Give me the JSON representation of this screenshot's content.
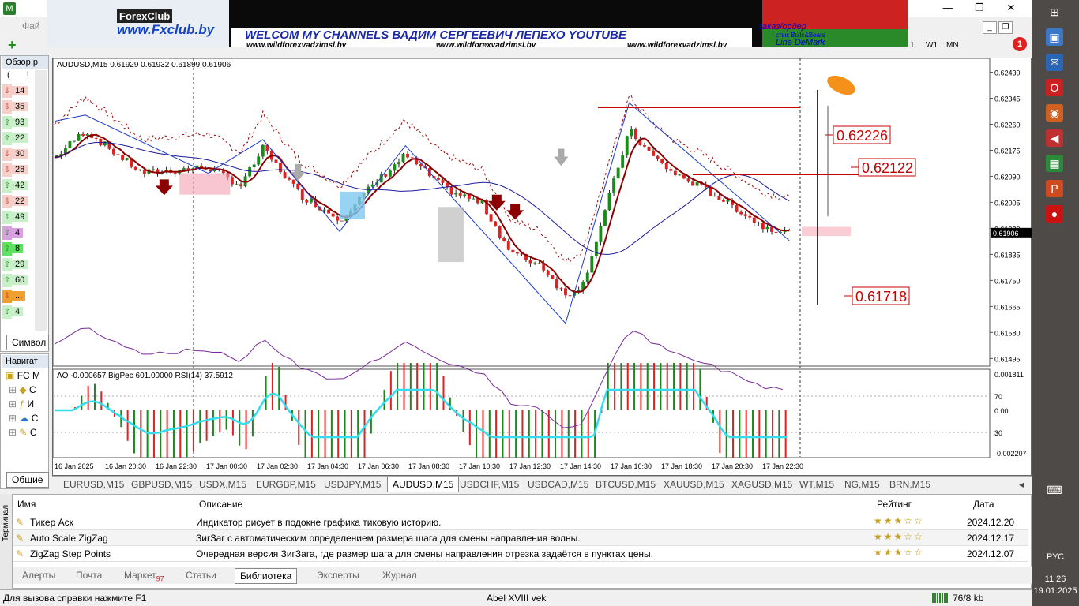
{
  "window": {
    "menu_file": "Фай"
  },
  "banner": {
    "forex_logo": "ForexClub",
    "fx_url": "www.Fxclub.by",
    "welcome": "WELCOM MY CHANNELS ВАДИМ СЕРГЕЕВИЧ ЛЕПЕХО YOUTUBE",
    "urls": [
      "www.wildforexvadzimsl.by",
      "www.wildforexvadzimsl.by",
      "www.wildforexvadzimsl.by"
    ],
    "order": "заказ/ордер",
    "bulls": "стык Bulls&Bears",
    "demark": "Line DeMark"
  },
  "toolbar": {
    "tf_1": "1",
    "tf_w1": "W1",
    "tf_mn": "MN",
    "notifications": "1"
  },
  "market_watch": {
    "title": "Обзор р",
    "head_left": "(",
    "head_right": "!",
    "rows": [
      {
        "value": "14",
        "dir": "down",
        "color": "#f6d0c8"
      },
      {
        "value": "35",
        "dir": "down",
        "color": "#f6d0c8"
      },
      {
        "value": "93",
        "dir": "up",
        "color": "#c8f0c8"
      },
      {
        "value": "22",
        "dir": "up",
        "color": "#c8f0c8"
      },
      {
        "value": "30",
        "dir": "down",
        "color": "#f6d0c8"
      },
      {
        "value": "28",
        "dir": "down",
        "color": "#f6d0c8"
      },
      {
        "value": "42",
        "dir": "up",
        "color": "#c8f0c8"
      },
      {
        "value": "22",
        "dir": "down",
        "color": "#f6d0c8"
      },
      {
        "value": "49",
        "dir": "up",
        "color": "#c8f0c8"
      },
      {
        "value": "4",
        "dir": "up",
        "color": "#d8a0e0"
      },
      {
        "value": "8",
        "dir": "up",
        "color": "#60e060"
      },
      {
        "value": "29",
        "dir": "up",
        "color": "#c8f0c8"
      },
      {
        "value": "60",
        "dir": "up",
        "color": "#c8f0c8"
      },
      {
        "value": "...",
        "dir": "down",
        "color": "#f0a030"
      },
      {
        "value": "4",
        "dir": "up",
        "color": "#c8f0c8"
      }
    ],
    "symbol_tab": "Символ"
  },
  "navigator": {
    "title": "Навигат",
    "root": "FC M",
    "items": [
      "С",
      "И",
      "С",
      "С"
    ],
    "common_tab": "Общие"
  },
  "chart": {
    "info": "AUDUSD,M15  0.61929 0.61932 0.61899 0.61906",
    "indicator_info": "AO -0.000657  BigPec 601.00000  RSI(14) 37.5912",
    "price_labels": [
      "0.62430",
      "0.62345",
      "0.62260",
      "0.62175",
      "0.62090",
      "0.62005",
      "0.61920",
      "0.61835",
      "0.61750",
      "0.61665",
      "0.61580",
      "0.61495"
    ],
    "current_price": "0.61906",
    "levels": [
      "0.62226",
      "0.62122",
      "0.61718"
    ],
    "sub_labels": [
      "0.001811",
      "70",
      "0.00",
      "30",
      "-0.002207"
    ],
    "time_labels": [
      "16 Jan 2025",
      "16 Jan 20:30",
      "16 Jan 22:30",
      "17 Jan 00:30",
      "17 Jan 02:30",
      "17 Jan 04:30",
      "17 Jan 06:30",
      "17 Jan 08:30",
      "17 Jan 10:30",
      "17 Jan 12:30",
      "17 Jan 14:30",
      "17 Jan 16:30",
      "17 Jan 18:30",
      "17 Jan 20:30",
      "17 Jan 22:30"
    ],
    "colors": {
      "bull": "#1a8a1a",
      "bear": "#dd2222",
      "ma": "#8b0000",
      "ma2": "#1a1a9a",
      "level": "#cc0000",
      "rsi": "#33ddee"
    }
  },
  "chart_tabs": [
    "EURUSD,M15",
    "GBPUSD,M15",
    "USDX,M15",
    "EURGBP,M15",
    "USDJPY,M15",
    "AUDUSD,M15",
    "USDCHF,M15",
    "USDCAD,M15",
    "BTCUSD,M15",
    "XAUUSD,M15",
    "XAGUSD,M15",
    "WT,M15",
    "NG,M15",
    "BRN,M15"
  ],
  "active_chart_tab": "AUDUSD,M15",
  "terminal": {
    "side_label": "Терминал",
    "headers": {
      "name": "Имя",
      "desc": "Описание",
      "rating": "Рейтинг",
      "date": "Дата"
    },
    "rows": [
      {
        "name": "Тикер Аск",
        "desc": "Индикатор рисует в подокне графика тиковую историю.",
        "stars": "★★★☆☆",
        "date": "2024.12.20"
      },
      {
        "name": "Auto Scale ZigZag",
        "desc": "ЗигЗаг с автоматическим определением размера шага для смены направления волны.",
        "stars": "★★★☆☆",
        "date": "2024.12.17"
      },
      {
        "name": "ZigZag Step Points",
        "desc": "Очередная версия ЗигЗага, где размер шага для смены направления отрезка задаётся в пунктах цены.",
        "stars": "★★★☆☆",
        "date": "2024.12.07"
      }
    ],
    "tabs": [
      {
        "label": "Алерты",
        "badge": ""
      },
      {
        "label": "Почта",
        "badge": ""
      },
      {
        "label": "Маркет",
        "badge": "97"
      },
      {
        "label": "Статьи",
        "badge": ""
      },
      {
        "label": "Библиотека",
        "badge": ""
      },
      {
        "label": "Эксперты",
        "badge": ""
      },
      {
        "label": "Журнал",
        "badge": ""
      }
    ],
    "active_tab": "Библиотека"
  },
  "status": {
    "help": "Для вызова справки нажмите F1",
    "profile": "Abel XVIII vek",
    "traffic": "76/8 kb"
  },
  "taskbar": {
    "lang": "РУС",
    "time": "11:26",
    "date": "19.01.2025",
    "icons": [
      "windows-icon",
      "explorer-icon",
      "outlook-icon",
      "opera-icon",
      "settings-icon",
      "volume-icon",
      "excel-icon",
      "powerpoint-icon",
      "record-icon",
      "keyboard-icon"
    ]
  }
}
